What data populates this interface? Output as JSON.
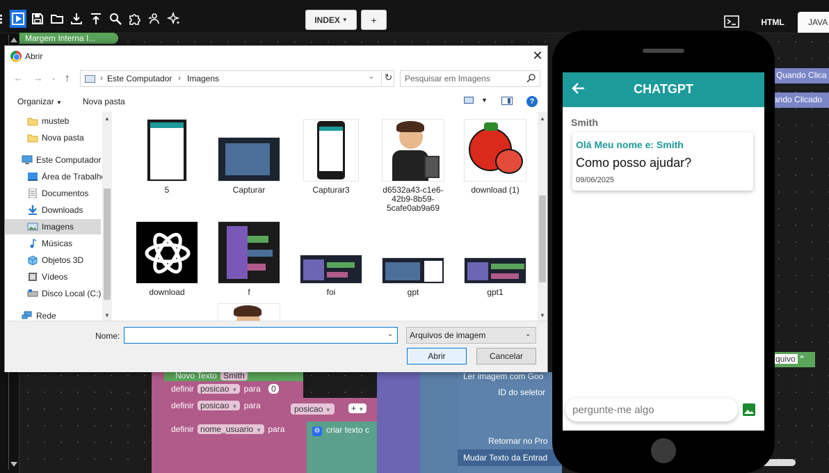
{
  "toolbar": {
    "icons": [
      "grid-icon",
      "play-icon",
      "save-icon",
      "folder-icon",
      "download-icon",
      "upload-icon",
      "search-icon",
      "puzzle-icon",
      "user-sync-icon",
      "sparkles-icon"
    ],
    "index_label": "INDEX",
    "plus_label": "+",
    "tab_html": "HTML",
    "tab_java": "JAVA"
  },
  "workspace": {
    "margem_label": "Margem   Interna I...",
    "quando1": "Quando Clica",
    "quando2": "ando Clicado",
    "arquivo": "quivo",
    "quote": "”",
    "novo_texto": "Novo Texto",
    "novo_texto_val": "Smith",
    "definir": "definir",
    "posicao": "posicao",
    "para": "para",
    "zero": "0",
    "plus": "+",
    "nome_usuario": "nome_usuario",
    "criar_texto": "criar texto c",
    "ler_imagem": "Ler imagem com Goo",
    "id_seletor": "ID do seletor",
    "retornar": "Retornar no Pro",
    "mudar_texto": "Mudar Texto da Entrad"
  },
  "dialog": {
    "title": "Abrir",
    "breadcrumb": [
      "Este Computador",
      "Imagens"
    ],
    "search_placeholder": "Pesquisar em Imagens",
    "organizar": "Organizar",
    "nova_pasta": "Nova pasta",
    "nav_items": [
      {
        "label": "musteb",
        "icon": "folder-icon"
      },
      {
        "label": "Nova pasta",
        "icon": "folder-icon"
      },
      {
        "label": "Este Computador",
        "icon": "computer-icon"
      },
      {
        "label": "Área de Trabalho",
        "icon": "desktop-icon"
      },
      {
        "label": "Documentos",
        "icon": "documents-icon"
      },
      {
        "label": "Downloads",
        "icon": "downloads-icon"
      },
      {
        "label": "Imagens",
        "icon": "pictures-icon"
      },
      {
        "label": "Músicas",
        "icon": "music-icon"
      },
      {
        "label": "Objetos 3D",
        "icon": "objects-3d-icon"
      },
      {
        "label": "Vídeos",
        "icon": "videos-icon"
      },
      {
        "label": "Disco Local (C:)",
        "icon": "disk-icon"
      },
      {
        "label": "Rede",
        "icon": "network-icon"
      }
    ],
    "files": [
      {
        "name": "5"
      },
      {
        "name": "Capturar"
      },
      {
        "name": "Capturar3"
      },
      {
        "name": "d6532a43-c1e6-42b9-8b59-5cafe0ab9a69"
      },
      {
        "name": "download (1)"
      },
      {
        "name": "download"
      },
      {
        "name": "f"
      },
      {
        "name": "foi"
      },
      {
        "name": "gpt"
      },
      {
        "name": "gpt1"
      }
    ],
    "nome_label": "Nome:",
    "nome_value": "",
    "file_type": "Arquivos de imagem",
    "abrir_btn": "Abrir",
    "cancelar_btn": "Cancelar"
  },
  "phone": {
    "app_title": "CHATGPT",
    "sender": "Smith",
    "greeting": "Olá Meu nome e: Smith",
    "message": "Como posso ajudar?",
    "date": "09/06/2025",
    "input_placeholder": "pergunte-me algo",
    "accent": "#1d9a9a"
  }
}
